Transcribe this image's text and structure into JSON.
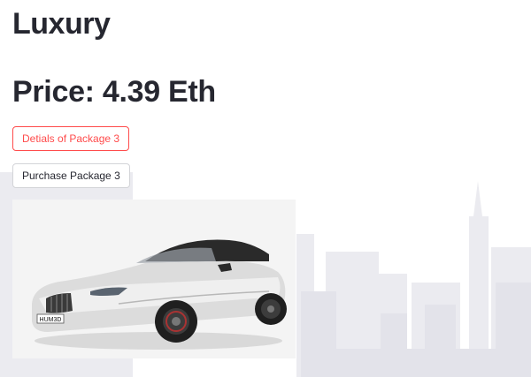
{
  "package": {
    "title": "Luxury",
    "price_text": "Price: 4.39 Eth"
  },
  "buttons": {
    "details_label": "Detials of Package 3",
    "purchase_label": "Purchase Package 3"
  },
  "car_image": {
    "plate_text": "HUM3D"
  },
  "colors": {
    "text": "#262730",
    "accent": "#ff4b4b",
    "border": "#d3d4d8",
    "skyline": "#e9e9ee"
  }
}
